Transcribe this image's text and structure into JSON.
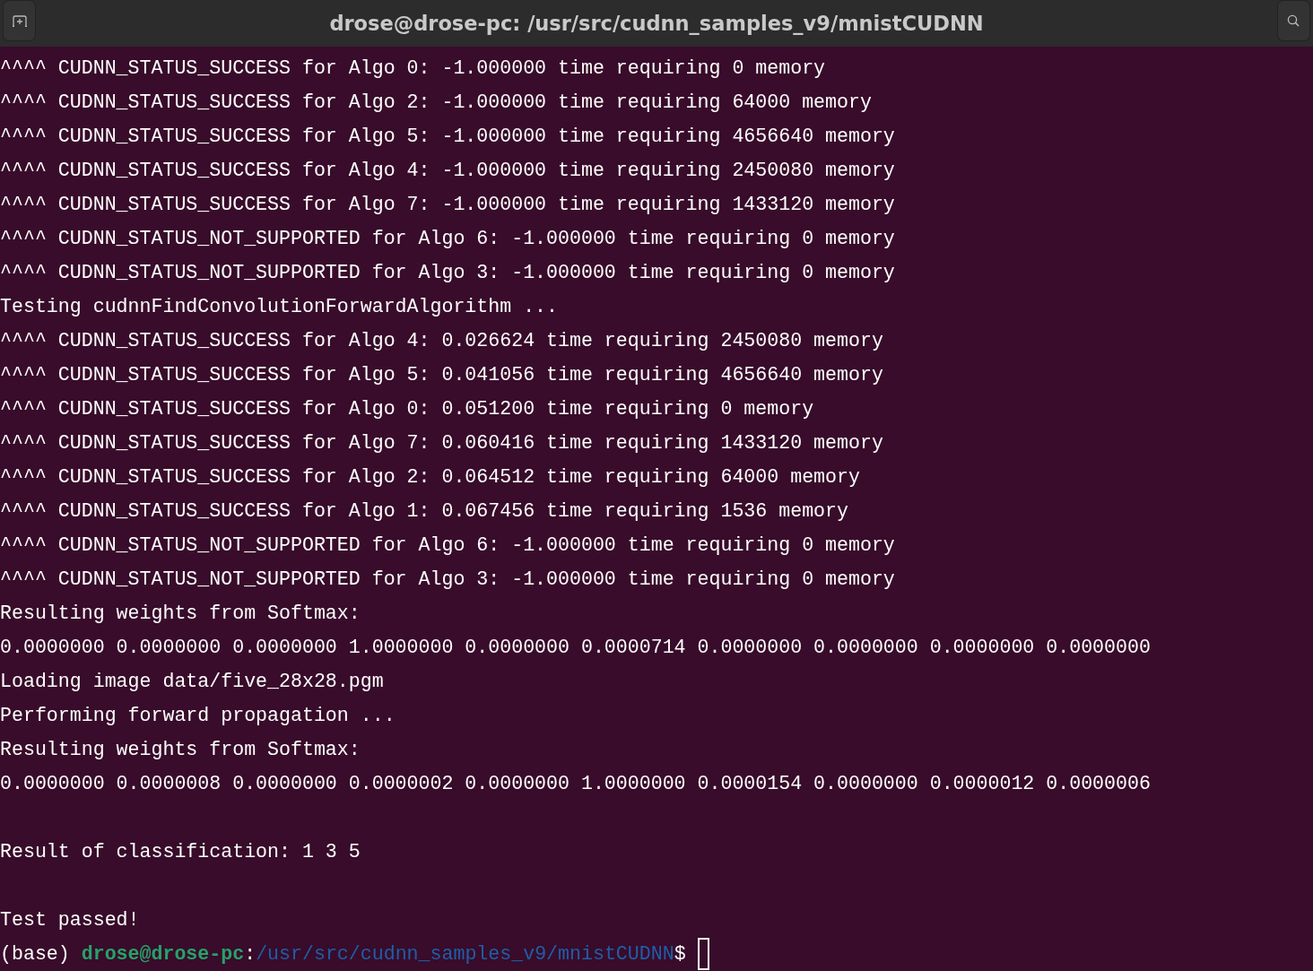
{
  "window": {
    "title": "drose@drose-pc: /usr/src/cudnn_samples_v9/mnistCUDNN"
  },
  "lines": [
    {
      "kind": "text",
      "text": "^^^^ CUDNN_STATUS_SUCCESS for Algo 0: -1.000000 time requiring 0 memory"
    },
    {
      "kind": "text",
      "text": "^^^^ CUDNN_STATUS_SUCCESS for Algo 2: -1.000000 time requiring 64000 memory"
    },
    {
      "kind": "text",
      "text": "^^^^ CUDNN_STATUS_SUCCESS for Algo 5: -1.000000 time requiring 4656640 memory"
    },
    {
      "kind": "text",
      "text": "^^^^ CUDNN_STATUS_SUCCESS for Algo 4: -1.000000 time requiring 2450080 memory"
    },
    {
      "kind": "text",
      "text": "^^^^ CUDNN_STATUS_SUCCESS for Algo 7: -1.000000 time requiring 1433120 memory"
    },
    {
      "kind": "text",
      "text": "^^^^ CUDNN_STATUS_NOT_SUPPORTED for Algo 6: -1.000000 time requiring 0 memory"
    },
    {
      "kind": "text",
      "text": "^^^^ CUDNN_STATUS_NOT_SUPPORTED for Algo 3: -1.000000 time requiring 0 memory"
    },
    {
      "kind": "text",
      "text": "Testing cudnnFindConvolutionForwardAlgorithm ..."
    },
    {
      "kind": "text",
      "text": "^^^^ CUDNN_STATUS_SUCCESS for Algo 4: 0.026624 time requiring 2450080 memory"
    },
    {
      "kind": "text",
      "text": "^^^^ CUDNN_STATUS_SUCCESS for Algo 5: 0.041056 time requiring 4656640 memory"
    },
    {
      "kind": "text",
      "text": "^^^^ CUDNN_STATUS_SUCCESS for Algo 0: 0.051200 time requiring 0 memory"
    },
    {
      "kind": "text",
      "text": "^^^^ CUDNN_STATUS_SUCCESS for Algo 7: 0.060416 time requiring 1433120 memory"
    },
    {
      "kind": "text",
      "text": "^^^^ CUDNN_STATUS_SUCCESS for Algo 2: 0.064512 time requiring 64000 memory"
    },
    {
      "kind": "text",
      "text": "^^^^ CUDNN_STATUS_SUCCESS for Algo 1: 0.067456 time requiring 1536 memory"
    },
    {
      "kind": "text",
      "text": "^^^^ CUDNN_STATUS_NOT_SUPPORTED for Algo 6: -1.000000 time requiring 0 memory"
    },
    {
      "kind": "text",
      "text": "^^^^ CUDNN_STATUS_NOT_SUPPORTED for Algo 3: -1.000000 time requiring 0 memory"
    },
    {
      "kind": "text",
      "text": "Resulting weights from Softmax:"
    },
    {
      "kind": "text",
      "text": "0.0000000 0.0000000 0.0000000 1.0000000 0.0000000 0.0000714 0.0000000 0.0000000 0.0000000 0.0000000"
    },
    {
      "kind": "text",
      "text": "Loading image data/five_28x28.pgm"
    },
    {
      "kind": "text",
      "text": "Performing forward propagation ..."
    },
    {
      "kind": "text",
      "text": "Resulting weights from Softmax:"
    },
    {
      "kind": "text",
      "text": "0.0000000 0.0000008 0.0000000 0.0000002 0.0000000 1.0000000 0.0000154 0.0000000 0.0000012 0.0000006"
    },
    {
      "kind": "blank"
    },
    {
      "kind": "text",
      "text": "Result of classification: 1 3 5"
    },
    {
      "kind": "blank"
    },
    {
      "kind": "text",
      "text": "Test passed!"
    }
  ],
  "prompt": {
    "env": "(base)",
    "user_host": "drose@drose-pc",
    "separator": ":",
    "path": "/usr/src/cudnn_samples_v9/mnistCUDNN",
    "symbol": "$"
  }
}
